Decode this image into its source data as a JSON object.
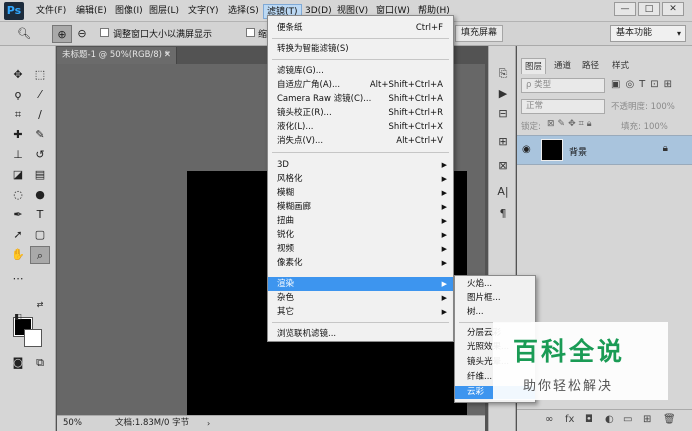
{
  "app": {
    "logo": "Ps",
    "menus": [
      "文件(F)",
      "编辑(E)",
      "图像(I)",
      "图层(L)",
      "文字(Y)",
      "选择(S)",
      "滤镜(T)",
      "3D(D)",
      "视图(V)",
      "窗口(W)",
      "帮助(H)"
    ],
    "active_menu_index": 6,
    "window_buttons": [
      "—",
      "□",
      "✕"
    ]
  },
  "options": {
    "resize_window_label": "调整窗口大小以满屏显示",
    "zoom_all_label": "缩放所有",
    "fill_screen_label": "填充屏幕",
    "workspace": "基本功能"
  },
  "document": {
    "tab_title": "未标题-1 @ 50%(RGB/8) *",
    "zoom": "50%",
    "status": "文档:1.83M/0 字节"
  },
  "filter_menu": {
    "items": [
      {
        "label": "便条纸",
        "shortcut": "Ctrl+F"
      },
      {
        "label": "转换为智能滤镜(S)"
      },
      {
        "label": "滤镜库(G)..."
      },
      {
        "label": "自适应广角(A)...",
        "shortcut": "Alt+Shift+Ctrl+A"
      },
      {
        "label": "Camera Raw 滤镜(C)...",
        "shortcut": "Shift+Ctrl+A"
      },
      {
        "label": "镜头校正(R)...",
        "shortcut": "Shift+Ctrl+R"
      },
      {
        "label": "液化(L)...",
        "shortcut": "Shift+Ctrl+X"
      },
      {
        "label": "消失点(V)...",
        "shortcut": "Alt+Ctrl+V"
      },
      {
        "label": "3D"
      },
      {
        "label": "风格化"
      },
      {
        "label": "模糊"
      },
      {
        "label": "模糊画廊"
      },
      {
        "label": "扭曲"
      },
      {
        "label": "锐化"
      },
      {
        "label": "视频"
      },
      {
        "label": "像素化"
      },
      {
        "label": "渲染"
      },
      {
        "label": "杂色"
      },
      {
        "label": "其它"
      },
      {
        "label": "浏览联机滤镜..."
      }
    ],
    "highlighted": "渲染"
  },
  "render_submenu": {
    "items": [
      "火焰...",
      "图片框...",
      "树...",
      "分层云彩",
      "光照效果...",
      "镜头光晕...",
      "纤维...",
      "云彩"
    ],
    "highlighted": "云彩"
  },
  "layers_panel": {
    "tabs": [
      "图层",
      "通道",
      "路径",
      "样式"
    ],
    "active_tab": "图层",
    "kind_filter": "ρ 类型",
    "blend_mode": "正常",
    "opacity_label": "不透明度: 100%",
    "lock_label": "锁定:",
    "fill_label": "填充: 100%",
    "layer_name": "背景",
    "bottom_icons": [
      "∞",
      "fx",
      "◘",
      "◐",
      "▭",
      "⊞",
      "🗑"
    ]
  },
  "watermark": {
    "title": "百科全说",
    "subtitle": "助你轻松解决"
  },
  "colors": {
    "menu_highlight": "#3d95ef",
    "watermark_green": "#1a9b55",
    "canvas_fill": "#000000",
    "workspace_bg": "#676767"
  }
}
